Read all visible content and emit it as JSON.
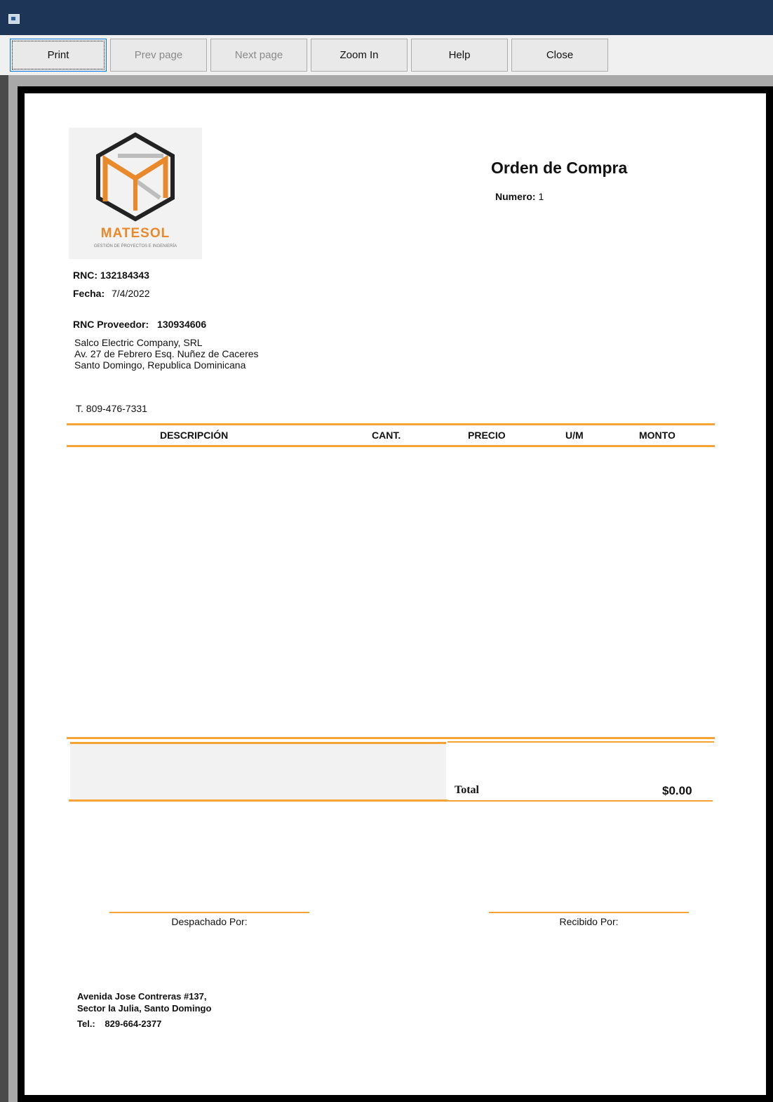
{
  "toolbar": {
    "print": "Print",
    "prev_page": "Prev page",
    "next_page": "Next page",
    "zoom_in": "Zoom In",
    "help": "Help",
    "close": "Close"
  },
  "colors": {
    "accent": "#f6a234",
    "titlebar": "#1d3557",
    "logo_orange": "#e8892b"
  },
  "logo": {
    "brand": "MATESOL",
    "tagline": "GESTIÓN DE PROYECTOS E INGENIERÍA"
  },
  "document": {
    "title": "Orden de Compra",
    "numero_label": "Numero:",
    "numero_value": "1",
    "rnc_label": "RNC:",
    "rnc_value": "132184343",
    "fecha_label": "Fecha:",
    "fecha_value": "7/4/2022",
    "rnc_proveedor_label": "RNC Proveedor:",
    "rnc_proveedor_value": "130934606",
    "supplier_lines": [
      "Salco Electric Company, SRL",
      "Av. 27 de Febrero Esq. Nuñez de Caceres",
      "Santo Domingo, Republica Dominicana"
    ],
    "phone": "T.  809-476-7331",
    "columns": [
      "DESCRIPCIÓN",
      "CANT.",
      "PRECIO",
      "U/M",
      "MONTO"
    ],
    "total_label": "Total",
    "total_value": "$0.00",
    "despachado_label": "Despachado Por:",
    "recibido_label": "Recibido Por:",
    "footer_lines": [
      "Avenida Jose Contreras #137,",
      "Sector la Julia, Santo Domingo"
    ],
    "tel_label": "Tel.:",
    "tel_value": "829-664-2377"
  }
}
